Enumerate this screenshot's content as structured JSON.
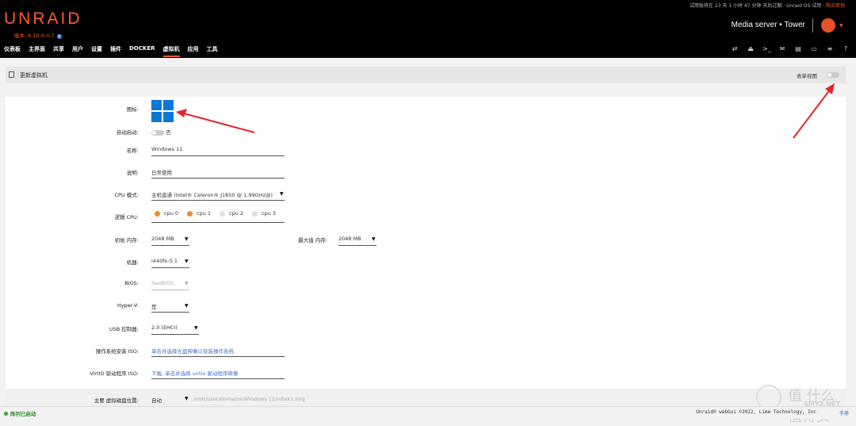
{
  "header": {
    "trial_text": "试用版将在 23 天 1 小时 47 分钟 天后过期 · Unraid OS 试用 ·",
    "buy_key": "购买密钥",
    "logo": "UNRAID",
    "version": "版本: 6.10.0-rc7",
    "server_name": "Media server • Tower",
    "nav": [
      "仪表板",
      "主界面",
      "共享",
      "用户",
      "设置",
      "插件",
      "DOCKER",
      "虚拟机",
      "应用",
      "工具"
    ],
    "active_nav": "虚拟机",
    "icons": [
      "transfer-icon",
      "logout-icon",
      "terminal-icon",
      "feedback-icon",
      "info-icon",
      "display-icon",
      "log-icon",
      "help-icon"
    ]
  },
  "titlebar": {
    "title": "更新虚拟机",
    "form_view_label": "表单视图"
  },
  "form": {
    "icon_label": "图标:",
    "autostart_label": "自动启动:",
    "autostart_value": "否",
    "name_label": "名称:",
    "name_value": "Windows 11",
    "desc_label": "说明:",
    "desc_value": "日常使用",
    "cpu_mode_label": "CPU 模式:",
    "cpu_mode_value": "主机直通 (Intel® Celeron® J1850 @ 1.99GHz@)",
    "logical_cpu_label": "逻辑 CPU:",
    "cpus": [
      {
        "name": "cpu 0",
        "on": true
      },
      {
        "name": "cpu 1",
        "on": true
      },
      {
        "name": "cpu 2",
        "on": false
      },
      {
        "name": "cpu 3",
        "on": false
      }
    ],
    "init_mem_label": "初始 内存:",
    "init_mem_value": "2048 MB",
    "max_mem_label": "最大值 内存:",
    "max_mem_value": "2048 MB",
    "machine_label": "机器:",
    "machine_value": "i440fx-5.1",
    "bios_label": "BIOS:",
    "bios_value": "SeaBIOS",
    "hyperv_label": "Hyper-V:",
    "hyperv_value": "是",
    "usb_label": "USB 控制器:",
    "usb_value": "2.0 (EHCI)",
    "os_iso_label": "操作系统安装 ISO:",
    "os_iso_value": "单击并选择光盘映像以安装操作系统",
    "virtio_iso_label": "VirtIO 驱动程序 ISO:",
    "virtio_iso_value": "下载, 单击并选择 virtio 驱动程序映像",
    "vdisk_label": "主要 虚拟磁盘位置:",
    "vdisk_value": "自动",
    "vdisk_path": "/mnt/user/domains/Windows 11/vdisk1.img"
  },
  "footer": {
    "array_status": "阵列已启动",
    "copyright": "Unraid® webGui ©2022, Lime Technology, Inc",
    "manual": "手册"
  },
  "watermark": {
    "line1": "值 什么值得买",
    "line2": "SMYZ.NET"
  }
}
